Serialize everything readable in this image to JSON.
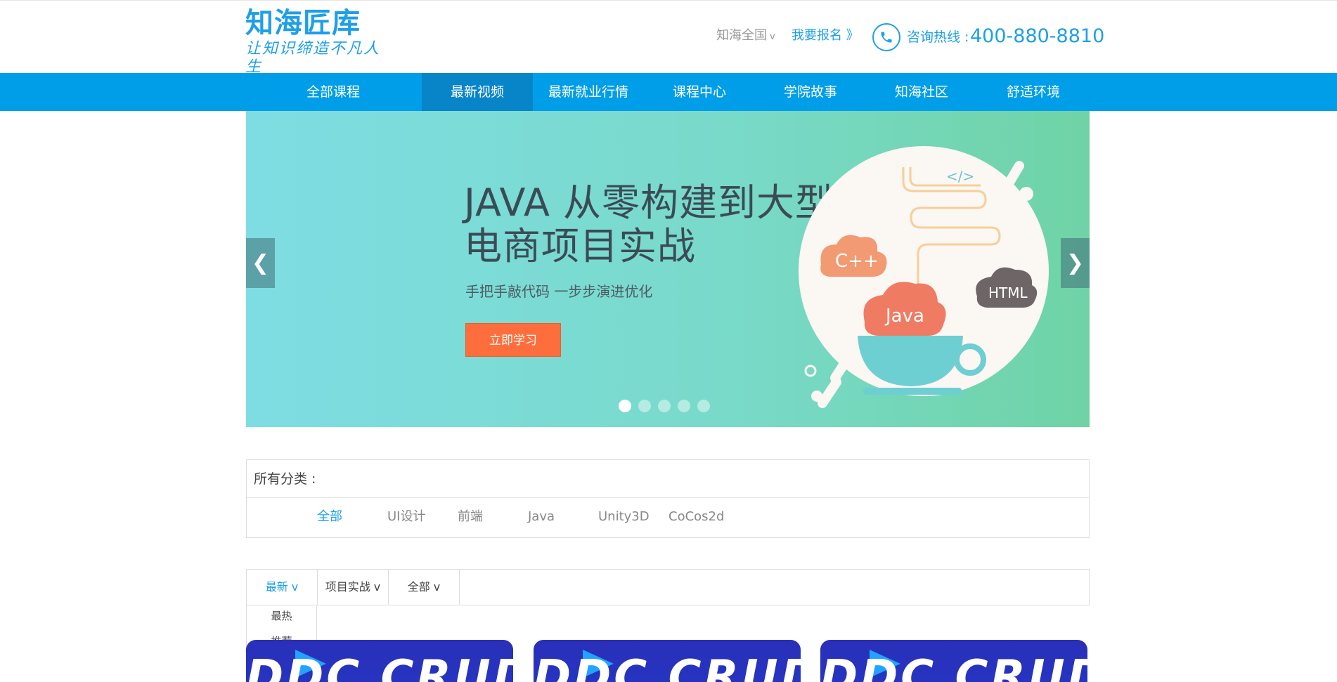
{
  "header": {
    "logo_main": "知海匠库",
    "logo_sub": "让知识缔造不凡人生",
    "region": "知海全国",
    "region_chevron": "v",
    "signup": "我要报名 》",
    "hotline_label": "咨询热线 :",
    "hotline_number": "400-880-8810"
  },
  "nav": {
    "items": [
      {
        "label": "全部课程"
      },
      {
        "label": "最新视频",
        "active": true
      },
      {
        "label": "最新就业行情"
      },
      {
        "label": "课程中心"
      },
      {
        "label": "学院故事"
      },
      {
        "label": "知海社区"
      },
      {
        "label": "舒适环境"
      }
    ]
  },
  "banner": {
    "title_line1": "JAVA 从零构建到大型",
    "title_line2": "电商项目实战",
    "subtitle": "手把手敲代码  一步步演进优化",
    "cta": "立即学习",
    "prev": "❮",
    "next": "❯",
    "slide_count": 5,
    "active_slide": 1,
    "art_labels": {
      "cpp": "C++",
      "java": "Java",
      "html": "HTML",
      "code": "</>"
    },
    "colors": {
      "cta": "#fe6e3c",
      "java_cloud": "#f07b63",
      "cpp_cloud": "#f29a72",
      "html_cloud": "#6e6566",
      "cup": "#6ecfd2"
    }
  },
  "categories": {
    "title": "所有分类 :",
    "items": [
      {
        "label": "全部",
        "active": true
      },
      {
        "label": "UI设计"
      },
      {
        "label": "前端"
      },
      {
        "label": "Java"
      },
      {
        "label": "Unity3D"
      },
      {
        "label": "CoCos2d"
      }
    ]
  },
  "filters": {
    "sort": "最新 v",
    "type": "项目实战 v",
    "scope": "全部 v",
    "sort_options": [
      "最热",
      "推荐"
    ]
  },
  "cards": [
    {
      "cover_text": "DDC CRUD"
    },
    {
      "cover_text": "DDC CRUD"
    },
    {
      "cover_text": "DDC CRUD"
    }
  ],
  "colors": {
    "brand": "#1e9fe8",
    "nav_bg": "#009ee8",
    "nav_active": "#0884c8"
  }
}
